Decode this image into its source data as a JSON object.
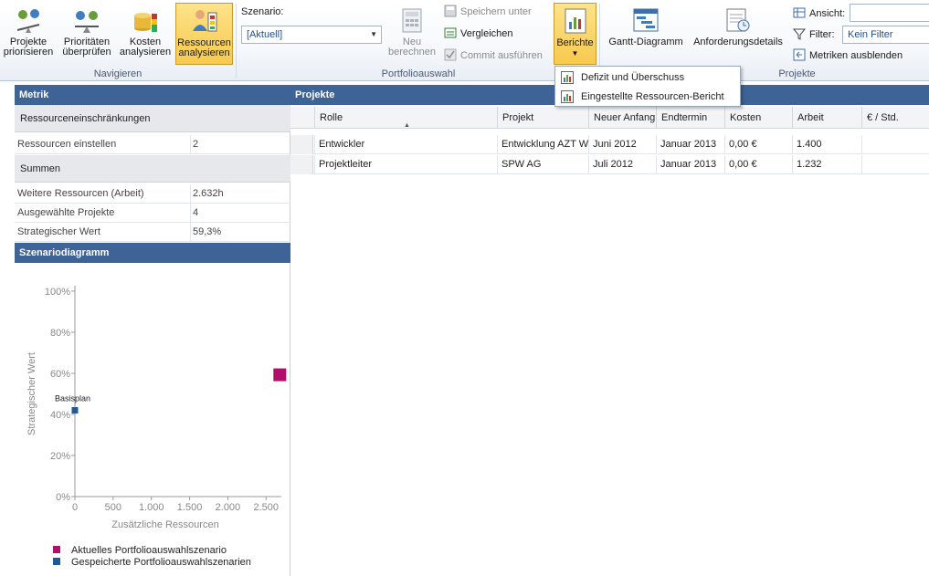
{
  "ribbon": {
    "groups": {
      "navigate": "Navigieren",
      "portfolio": "Portfolioauswahl",
      "projects": "Projekte"
    },
    "buttons": {
      "prioritize": "Projekte\npriorisieren",
      "priorities": "Prioritäten\nüberprüfen",
      "costs": "Kosten\nanalysieren",
      "resources": "Ressourcen\nanalysieren",
      "recalc": "Neu\nberechnen",
      "reports": "Berichte",
      "gantt": "Gantt-Diagramm",
      "requirements": "Anforderungsdetails"
    },
    "scenario_label": "Szenario:",
    "scenario_value": "[Aktuell]",
    "save_as": "Speichern unter",
    "compare": "Vergleichen",
    "commit": "Commit ausführen",
    "view_label": "Ansicht:",
    "view_value": "",
    "filter_label": "Filter:",
    "filter_value": "Kein Filter",
    "hide_metrics": "Metriken ausblenden"
  },
  "reports_menu": {
    "items": [
      {
        "label": "Defizit und Überschuss"
      },
      {
        "label": "Eingestellte Ressourcen-Bericht"
      }
    ]
  },
  "metrics": {
    "title": "Metrik",
    "section1": "Ressourceneinschränkungen",
    "rows1": [
      {
        "key": "Ressourcen einstellen",
        "value": "2"
      }
    ],
    "section2": "Summen",
    "rows2": [
      {
        "key": "Weitere Ressourcen (Arbeit)",
        "value": "2.632h"
      },
      {
        "key": "Ausgewählte Projekte",
        "value": "4"
      },
      {
        "key": "Strategischer Wert",
        "value": "59,3%"
      }
    ]
  },
  "scenario_chart": {
    "title": "Szenariodiagramm"
  },
  "projects": {
    "title": "Projekte",
    "columns": [
      "Rolle",
      "Projekt",
      "Neuer Anfang",
      "Endtermin",
      "Kosten",
      "Arbeit",
      "€ / Std."
    ],
    "rows": [
      [
        "Entwickler",
        "Entwicklung AZT We",
        "Juni 2012",
        "Januar 2013",
        "0,00 €",
        "1.400",
        ""
      ],
      [
        "Projektleiter",
        "SPW AG",
        "Juli 2012",
        "Januar 2013",
        "0,00 €",
        "1.232",
        ""
      ]
    ]
  },
  "chart_data": {
    "type": "scatter",
    "title": "",
    "xlabel": "Zusätzliche Ressourcen",
    "ylabel": "Strategischer Wert",
    "xlim": [
      0,
      2700
    ],
    "ylim": [
      0,
      100
    ],
    "x_ticks": [
      "0",
      "500",
      "1.000",
      "1.500",
      "2.000",
      "2.500"
    ],
    "x_tick_values": [
      0,
      500,
      1000,
      1500,
      2000,
      2500
    ],
    "y_ticks": [
      "0%",
      "20%",
      "40%",
      "60%",
      "80%",
      "100%"
    ],
    "y_tick_values": [
      0,
      20,
      40,
      60,
      80,
      100
    ],
    "series": [
      {
        "name": "Aktuelles Portfolioauswahlszenario",
        "color": "#b0106a",
        "points": [
          {
            "x": 2632,
            "y": 59.3
          }
        ]
      },
      {
        "name": "Gespeicherte Portfolioauswahlszenarien",
        "color": "#1f5a95",
        "points": [
          {
            "x": 0,
            "y": 42,
            "label": "Basisplan"
          }
        ]
      }
    ],
    "legend_position": "bottom",
    "grid": false
  }
}
